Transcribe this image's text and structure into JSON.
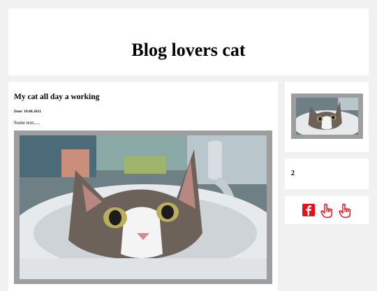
{
  "header": {
    "title": "Blog lovers cat"
  },
  "post": {
    "title": "My cat all day a working",
    "date": "Date: 10.08.2021",
    "body": "Some text.....",
    "image_alt": "Tabby and white cat peeking out of a bathroom sink"
  },
  "sidebar": {
    "thumbnail_alt": "Cat in sink thumbnail",
    "count": "2",
    "social": [
      "facebook-icon",
      "hand-pointer-icon",
      "hand-pointer-icon"
    ]
  },
  "colors": {
    "page_bg": "#f1f1f1",
    "card_bg": "#ffffff",
    "frame": "#9e9e9e",
    "social": "#e8111b"
  }
}
